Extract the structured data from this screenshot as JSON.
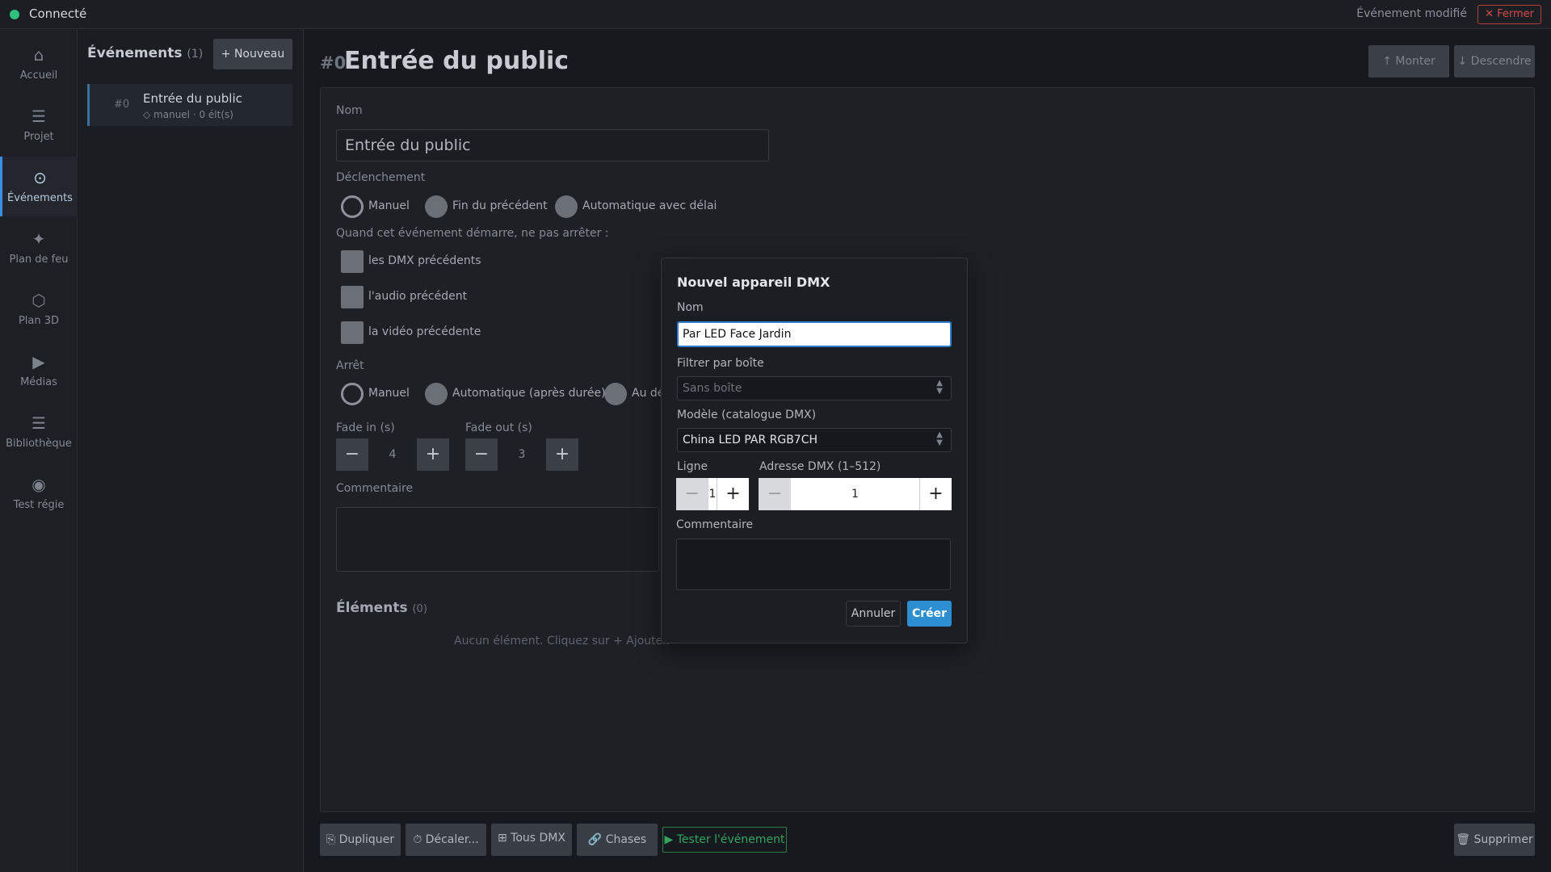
{
  "topbar": {
    "status": "Connecté",
    "modified": "Événement modifié",
    "close_label": "✕ Fermer"
  },
  "nav": [
    {
      "icon": "⌂",
      "label": "Accueil"
    },
    {
      "icon": "☰",
      "label": "Projet"
    },
    {
      "icon": "⊙",
      "label": "Événements"
    },
    {
      "icon": "✦",
      "label": "Plan de feu"
    },
    {
      "icon": "⬡",
      "label": "Plan 3D"
    },
    {
      "icon": "▶",
      "label": "Médias"
    },
    {
      "icon": "☰",
      "label": "Bibliothèque"
    },
    {
      "icon": "◉",
      "label": "Test régie"
    }
  ],
  "list": {
    "title": "Événements",
    "count": "(1)",
    "new_label": "+ Nouveau",
    "item": {
      "num": "#0",
      "name": "Entrée du public",
      "sub": "◇ manuel · 0 élt(s)"
    }
  },
  "header": {
    "num": "#0",
    "title": "Entrée du public",
    "up_label": "↑ Monter",
    "down_label": "↓ Descendre"
  },
  "form": {
    "name_label": "Nom",
    "name_value": "Entrée du public",
    "trigger_label": "Déclenchement",
    "trigger_options": [
      "Manuel",
      "Fin du précédent",
      "Automatique avec délai"
    ],
    "no_stop_label": "Quand cet événement démarre, ne pas arrêter :",
    "no_stop_options": [
      "les DMX précédents",
      "l'audio précédent",
      "la vidéo précédente"
    ],
    "stop_label": "Arrêt",
    "stop_options": [
      "Manuel",
      "Automatique (après durée)",
      "Au dé"
    ],
    "fade_in_label": "Fade in (s)",
    "fade_in_value": "4",
    "fade_out_label": "Fade out (s)",
    "fade_out_value": "3",
    "comment_label": "Commentaire",
    "elements_title": "Éléments",
    "elements_count": "(0)",
    "empty_msg": "Aucun élément. Cliquez sur + Ajouter."
  },
  "bottom": {
    "duplicate": "⎘ Dupliquer",
    "shift": "⏱ Décaler...",
    "all_dmx": "⊞ Tous DMX",
    "chases": "🔗 Chases",
    "test": "▶ Tester l'événement",
    "delete": "🗑 Supprimer"
  },
  "modal": {
    "title": "Nouvel appareil DMX",
    "name_label": "Nom",
    "name_value": "Par LED Face Jardin",
    "filter_label": "Filtrer par boîte",
    "filter_value": "Sans boîte",
    "model_label": "Modèle (catalogue DMX)",
    "model_value": "China LED PAR RGB7CH",
    "line_label": "Ligne",
    "line_value": "1",
    "address_label": "Adresse DMX (1–512)",
    "address_value": "1",
    "comment_label": "Commentaire",
    "cancel_label": "Annuler",
    "create_label": "Créer"
  },
  "colors": {
    "accent": "#2d8fd1",
    "connected": "#2ec27e",
    "danger": "#d24b4b",
    "test_green": "#33a35f"
  }
}
